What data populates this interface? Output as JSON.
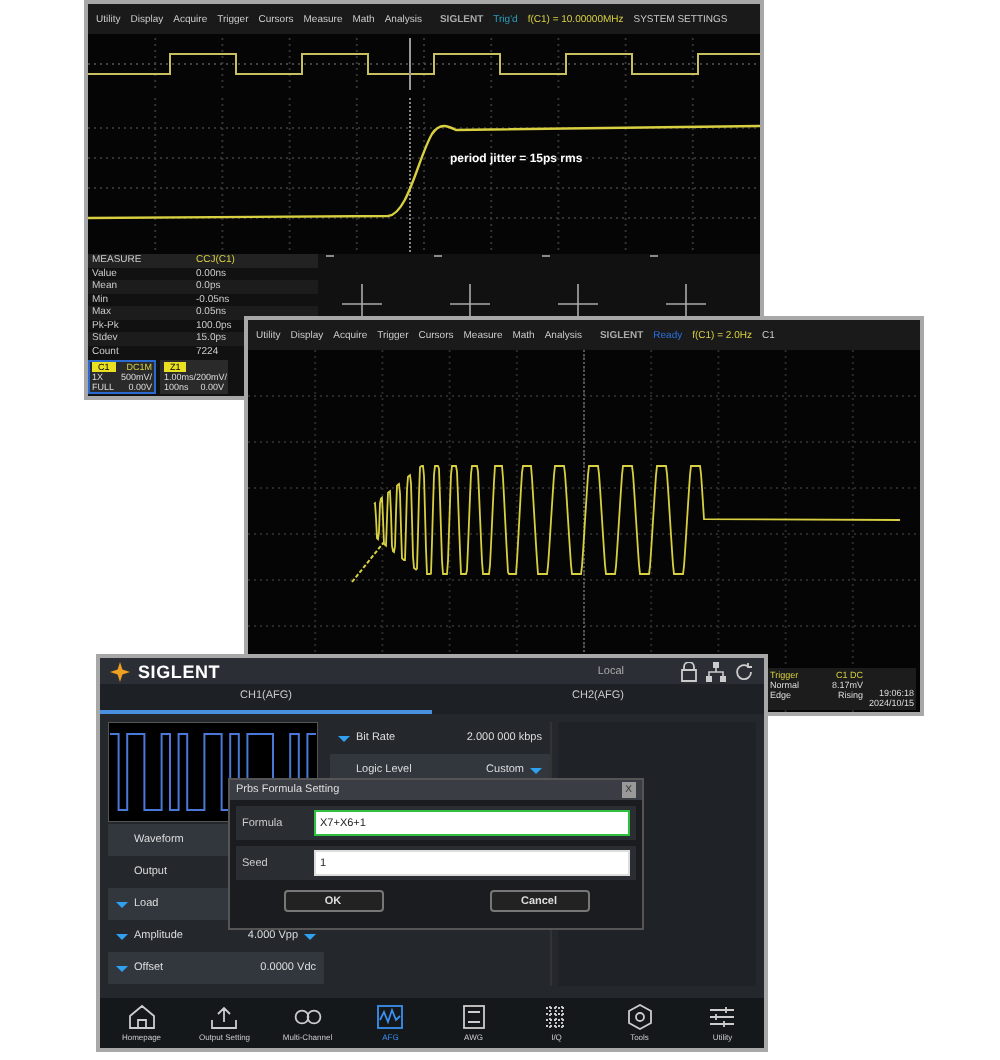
{
  "scope_top": {
    "menu": [
      "Utility",
      "Display",
      "Acquire",
      "Trigger",
      "Cursors",
      "Measure",
      "Math",
      "Analysis"
    ],
    "brand": "SIGLENT",
    "status": "Trig'd",
    "frequency": "f(C1) = 10.00000MHz",
    "settings": "SYSTEM SETTINGS",
    "annotation": "period jitter = 15ps rms",
    "measure": {
      "title": "MEASURE",
      "source": "CCJ(C1)",
      "rows": [
        {
          "label": "Value",
          "value": "0.00ns"
        },
        {
          "label": "Mean",
          "value": "0.0ps"
        },
        {
          "label": "Min",
          "value": "-0.05ns"
        },
        {
          "label": "Max",
          "value": "0.05ns"
        },
        {
          "label": "Pk-Pk",
          "value": "100.0ps"
        },
        {
          "label": "Stdev",
          "value": "15.0ps"
        },
        {
          "label": "Count",
          "value": "7224"
        }
      ]
    },
    "channels": [
      {
        "name": "C1",
        "tag": "DC1M",
        "lines": [
          [
            "1X",
            "500mV/"
          ],
          [
            "FULL",
            "0.00V"
          ]
        ]
      },
      {
        "name": "Z1",
        "lines": [
          [
            "1.00ms/",
            "200mV/"
          ],
          [
            "100ns",
            "0.00V"
          ]
        ]
      }
    ]
  },
  "scope_bottom": {
    "menu": [
      "Utility",
      "Display",
      "Acquire",
      "Trigger",
      "Cursors",
      "Measure",
      "Math",
      "Analysis"
    ],
    "brand": "SIGLENT",
    "status": "Ready",
    "frequency": "f(C1) = 2.0Hz",
    "channel": "C1",
    "trigger": {
      "title": "Trigger",
      "source": "C1 DC",
      "rows": [
        [
          "Normal",
          "8.17mV"
        ],
        [
          "Edge",
          "Rising"
        ]
      ],
      "time": "19:06:18",
      "date": "2024/10/15"
    }
  },
  "generator": {
    "brand": "SIGLENT",
    "mode": "Local",
    "tabs": [
      {
        "label": "CH1(AFG)",
        "selected": true
      },
      {
        "label": "CH2(AFG)",
        "selected": false
      }
    ],
    "params": [
      {
        "label": "Bit Rate",
        "value": "2.000 000 kbps",
        "label_caret": true,
        "value_caret": false
      },
      {
        "label": "Logic Level",
        "value": "Custom",
        "label_caret": false,
        "value_caret": true
      }
    ],
    "menu": [
      {
        "label": "Waveform",
        "label_caret": false,
        "value_caret": false
      },
      {
        "label": "Output",
        "label_caret": false,
        "value_caret": false
      },
      {
        "label": "Load",
        "label_caret": true,
        "value_caret": false
      },
      {
        "label": "Amplitude",
        "value": "4.000 Vpp",
        "label_caret": true,
        "value_caret": true
      },
      {
        "label": "Offset",
        "value": "0.0000 Vdc",
        "label_caret": true,
        "value_caret": false
      }
    ],
    "dialog": {
      "title": "Prbs Formula Setting",
      "close": "X",
      "fields": [
        {
          "label": "Formula",
          "value": "X7+X6+1",
          "focused": true
        },
        {
          "label": "Seed",
          "value": "1",
          "focused": false
        }
      ],
      "buttons": [
        "OK",
        "Cancel"
      ]
    },
    "nav": [
      {
        "label": "Homepage",
        "selected": false
      },
      {
        "label": "Output Setting",
        "selected": false
      },
      {
        "label": "Multi-Channel",
        "selected": false
      },
      {
        "label": "AFG",
        "selected": true
      },
      {
        "label": "AWG",
        "selected": false
      },
      {
        "label": "I/Q",
        "selected": false
      },
      {
        "label": "Tools",
        "selected": false
      },
      {
        "label": "Utility",
        "selected": false
      }
    ]
  }
}
